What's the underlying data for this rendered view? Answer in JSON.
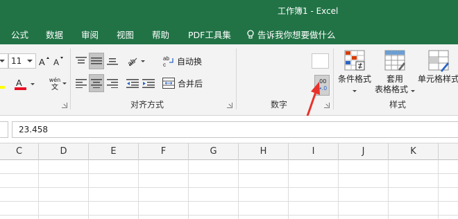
{
  "window": {
    "title": "工作簿1  -  Excel"
  },
  "menu": {
    "items": [
      "公式",
      "数据",
      "审阅",
      "视图",
      "帮助",
      "PDF工具集"
    ],
    "tell_me": "告诉我你想要做什么"
  },
  "ribbon": {
    "font_size": "11",
    "wrap_text": "自动换",
    "merge_center": "合并后",
    "alignment_label": "对齐方式",
    "number_label": "数字",
    "styles_label": "样式",
    "conditional_format": "条件格式",
    "format_table_line1": "套用",
    "format_table_line2": "表格格式",
    "cell_styles": "单元格样式",
    "phonetic_top": "wén",
    "phonetic_bottom": "文",
    "decimal_top": ".00",
    "decimal_bottom": "→.0"
  },
  "formula_bar": {
    "value": "23.458"
  },
  "columns": [
    "C",
    "D",
    "E",
    "F",
    "G",
    "H",
    "I",
    "J",
    "K"
  ],
  "colors": {
    "excel_green": "#217346",
    "annotation_red": "#e8322b",
    "font_color_bar": "#e81123"
  }
}
